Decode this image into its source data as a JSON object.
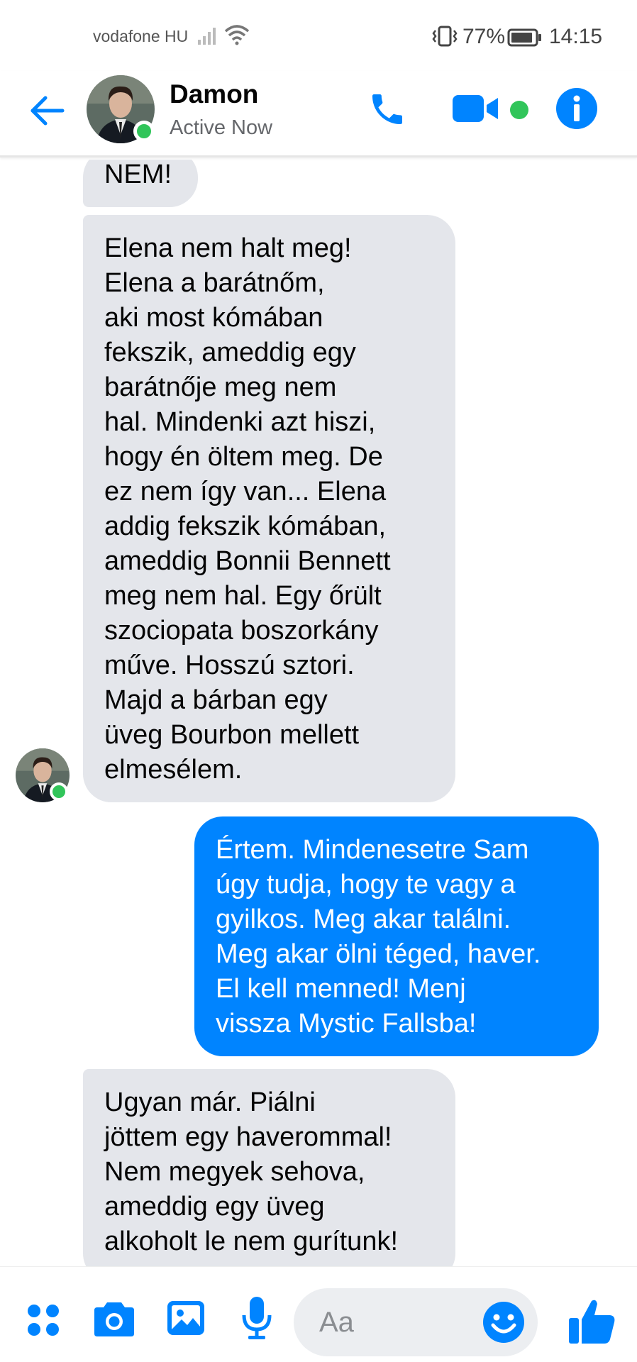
{
  "status_bar": {
    "carrier": "vodafone HU",
    "battery": "77%",
    "time": "14:15"
  },
  "header": {
    "contact_name": "Damon",
    "contact_status": "Active Now",
    "icons": [
      "back-arrow-icon",
      "phone-icon",
      "video-camera-icon",
      "info-icon"
    ]
  },
  "messages": [
    {
      "sender": "contact",
      "text": "NEM!"
    },
    {
      "sender": "contact",
      "text": "Elena nem halt meg!\nElena a barátnőm,\naki most kómában\nfekszik, ameddig egy\nbarátnője meg nem\nhal. Mindenki azt hiszi,\nhogy én öltem meg. De\nez nem így van... Elena\naddig fekszik kómában,\nameddig Bonnii Bennett\nmeg nem hal. Egy őrült\nszociopata boszorkány\nműve. Hosszú sztori.\nMajd a bárban egy\nüveg Bourbon mellett\nelmesélem."
    },
    {
      "sender": "me",
      "text": "Értem. Mindenesetre Sam\núgy tudja, hogy te vagy a\ngyilkos. Meg akar találni.\nMeg akar ölni téged, haver.\nEl kell menned! Menj\nvissza Mystic Fallsba!"
    },
    {
      "sender": "contact",
      "text": "Ugyan már. Piálni\njöttem egy haverommal!\nNem megyek sehova,\nameddig egy üveg\nalkoholt le nem gurítunk!"
    }
  ],
  "composer": {
    "placeholder": "Aa",
    "icons": [
      "more-icon",
      "camera-icon",
      "gallery-icon",
      "microphone-icon",
      "emoji-icon",
      "thumbs-up-icon"
    ]
  },
  "colors": {
    "accent": "#0084ff",
    "online": "#31c55a",
    "incoming_bubble": "#e4e6eb"
  }
}
